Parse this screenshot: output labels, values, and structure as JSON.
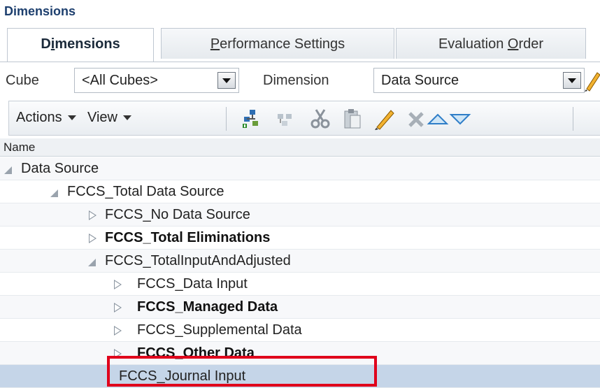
{
  "page_heading": "Dimensions",
  "tabs": [
    {
      "label": "Dimensions",
      "underline_letter": "i",
      "active": true
    },
    {
      "label": "Performance Settings",
      "underline_letter": "P",
      "active": false
    },
    {
      "label": "Evaluation Order",
      "underline_letter": "O",
      "active": false
    }
  ],
  "filters": {
    "cube_label": "Cube",
    "cube_value": "<All Cubes>",
    "dimension_label": "Dimension",
    "dimension_value": "Data Source"
  },
  "toolbar": {
    "actions_label": "Actions",
    "view_label": "View",
    "icons": [
      "add-child-icon",
      "add-sibling-icon",
      "cut-icon",
      "paste-icon",
      "edit-pencil-icon",
      "delete-icon",
      "move-up-icon",
      "move-down-icon"
    ]
  },
  "table": {
    "column_header": "Name",
    "rows": [
      {
        "label": "Data Source",
        "toggle": "expanded",
        "bold": false,
        "selected": false
      },
      {
        "label": "FCCS_Total Data Source",
        "toggle": "expanded",
        "bold": false,
        "selected": false
      },
      {
        "label": "FCCS_No Data Source",
        "toggle": "collapsed",
        "bold": false,
        "selected": false
      },
      {
        "label": "FCCS_Total Eliminations",
        "toggle": "collapsed",
        "bold": true,
        "selected": false
      },
      {
        "label": "FCCS_TotalInputAndAdjusted",
        "toggle": "expanded",
        "bold": false,
        "selected": false
      },
      {
        "label": "FCCS_Data Input",
        "toggle": "collapsed",
        "bold": false,
        "selected": false
      },
      {
        "label": "FCCS_Managed Data",
        "toggle": "collapsed",
        "bold": true,
        "selected": false
      },
      {
        "label": "FCCS_Supplemental Data",
        "toggle": "collapsed",
        "bold": false,
        "selected": false
      },
      {
        "label": "FCCS_Other Data",
        "toggle": "collapsed",
        "bold": true,
        "selected": false
      },
      {
        "label": "FCCS_Journal Input",
        "toggle": "none",
        "bold": false,
        "selected": true
      }
    ]
  },
  "colors": {
    "heading": "#1d3f6e",
    "selected_row": "#c5d5e8",
    "highlight_box": "#e0001b"
  }
}
